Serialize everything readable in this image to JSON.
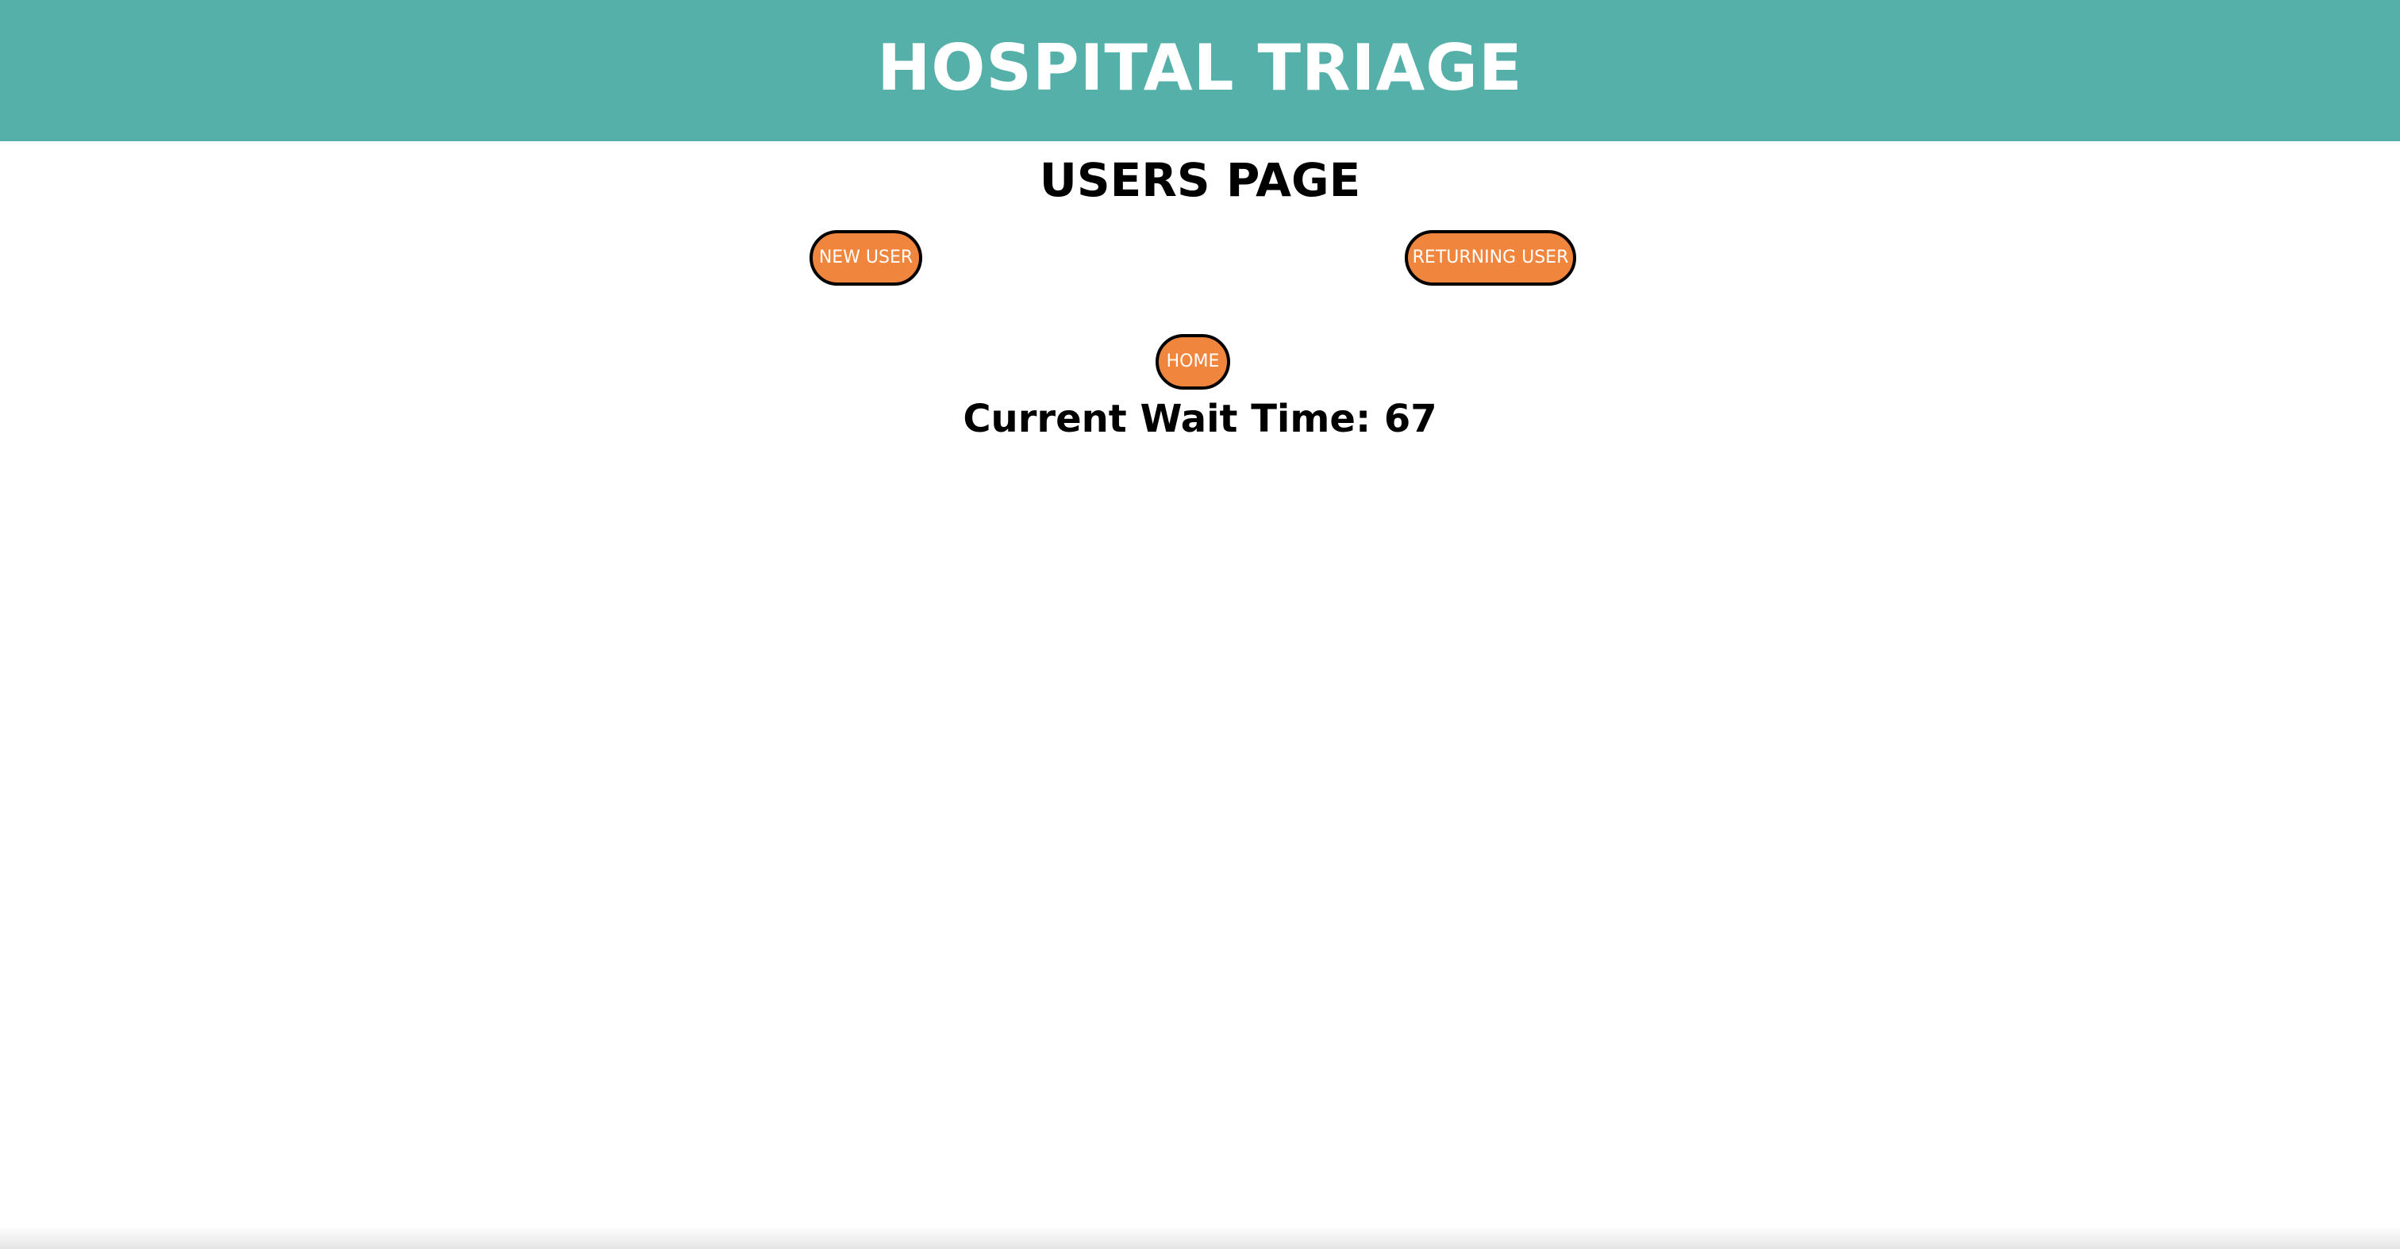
{
  "header": {
    "title": "HOSPITAL TRIAGE"
  },
  "main": {
    "page_title": "USERS PAGE",
    "buttons": {
      "new_user": "NEW USER",
      "returning_user": "RETURNING USER",
      "home": "HOME"
    },
    "wait_time": {
      "label": "Current Wait Time:",
      "value": "67"
    }
  },
  "colors": {
    "header_bg": "#55b0aa",
    "button_bg": "#f0863e",
    "button_border": "#000000",
    "text": "#000000"
  }
}
